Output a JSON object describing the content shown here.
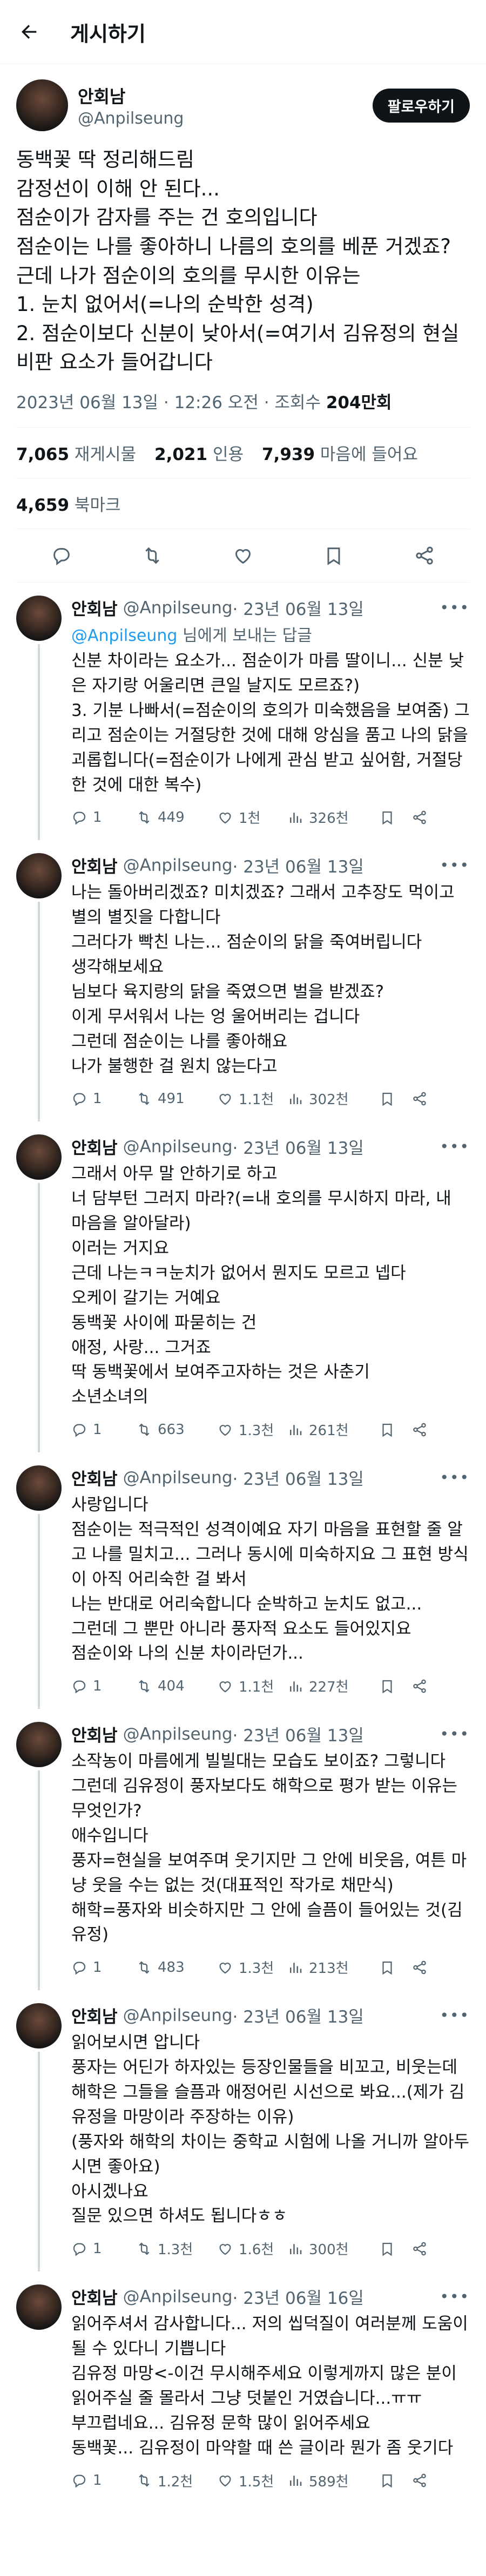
{
  "header": {
    "title": "게시하기"
  },
  "tweet": {
    "author": "안회남",
    "handle": "@Anpilseung",
    "follow_label": "팔로우하기",
    "text": "동백꽃 딱 정리해드림\n감정선이 이해 안 된다...\n점순이가 감자를 주는 건 호의입니다\n점순이는 나를 좋아하니 나름의 호의를 베푼 거겠죠?\n근데 나가 점순이의 호의를 무시한 이유는\n1. 눈치 없어서(=나의 순박한 성격)\n2. 점순이보다 신분이 낮아서(=여기서 김유정의 현실 비판 요소가 들어갑니다",
    "time": "2023년 06월 13일 · 12:26 오전 · 조회수 ",
    "views": "204만회",
    "stats": {
      "retweets_num": "7,065",
      "retweets_label": "재게시물",
      "quotes_num": "2,021",
      "quotes_label": "인용",
      "likes_num": "7,939",
      "likes_label": "마음에 들어요",
      "bookmarks_num": "4,659",
      "bookmarks_label": "북마크"
    }
  },
  "replies": [
    {
      "name": "안회남",
      "handle": "@Anpilseung",
      "date": "· 23년 06월 13일",
      "replying_mention": "@Anpilseung",
      "replying_suffix": " 님에게 보내는 답글",
      "text": "신분 차이라는 요소가... 점순이가 마름 딸이니... 신분 낮은 자기랑 어울리면 큰일 날지도 모르죠?)\n3. 기분 나빠서(=점순이의 호의가 미숙했음을 보여줌) 그리고 점순이는 거절당한 것에 대해 앙심을 품고 나의 닭을 괴롭힙니다(=점순이가 나에게 관심 받고 싶어함, 거절당한 것에 대한 복수)",
      "comments": "1",
      "retweets": "449",
      "likes": "1천",
      "views": "326천"
    },
    {
      "name": "안회남",
      "handle": "@Anpilseung",
      "date": "· 23년 06월 13일",
      "text": "나는 돌아버리겠죠? 미치겠죠? 그래서 고추장도 먹이고 별의 별짓을 다합니다\n그러다가 빡친 나는... 점순이의 닭을 죽여버립니다\n생각해보세요\n님보다 육지랑의 닭을 죽였으면 벌을 받겠죠?\n이게 무서워서 나는 엉 울어버리는 겁니다\n그런데 점순이는 나를 좋아해요\n나가 불행한 걸 원치 않는다고",
      "comments": "1",
      "retweets": "491",
      "likes": "1.1천",
      "views": "302천"
    },
    {
      "name": "안회남",
      "handle": "@Anpilseung",
      "date": "· 23년 06월 13일",
      "text": "그래서 아무 말 안하기로 하고\n너 담부턴 그러지 마라?(=내 호의를 무시하지 마라, 내 마음을 알아달라)\n이러는 거지요\n근데 나는ㅋㅋ눈치가 없어서 뭔지도 모르고 넵다\n오케이 갈기는 거예요\n동백꽃 사이에 파묻히는 건\n애정, 사랑... 그거죠\n딱 동백꽃에서 보여주고자하는 것은 사춘기\n소년소녀의",
      "comments": "1",
      "retweets": "663",
      "likes": "1.3천",
      "views": "261천"
    },
    {
      "name": "안회남",
      "handle": "@Anpilseung",
      "date": "· 23년 06월 13일",
      "text": "사랑입니다\n점순이는 적극적인 성격이예요 자기 마음을 표현할 줄 알고 나를 밀치고... 그러나 동시에 미숙하지요 그 표현 방식이 아직 어리숙한 걸 봐서\n나는 반대로 어리숙합니다 순박하고 눈치도 없고...\n그런데 그 뿐만 아니라 풍자적 요소도 들어있지요\n점순이와 나의 신분 차이라던가...",
      "comments": "1",
      "retweets": "404",
      "likes": "1.1천",
      "views": "227천"
    },
    {
      "name": "안회남",
      "handle": "@Anpilseung",
      "date": "· 23년 06월 13일",
      "text": "소작농이 마름에게 빌빌대는 모습도 보이죠? 그렇니다\n그런데 김유정이 풍자보다도 해학으로 평가 받는 이유는 무엇인가?\n애수입니다\n풍자=현실을 보여주며 웃기지만 그 안에 비웃음, 여튼 마냥 웃을 수는 없는 것(대표적인 작가로 채만식)\n해학=풍자와 비슷하지만 그 안에 슬픔이 들어있는 것(김유정)",
      "comments": "1",
      "retweets": "483",
      "likes": "1.3천",
      "views": "213천"
    },
    {
      "name": "안회남",
      "handle": "@Anpilseung",
      "date": "· 23년 06월 13일",
      "text": "읽어보시면 압니다\n풍자는 어딘가 하자있는 등장인물들을 비꼬고, 비웃는데\n해학은 그들을 슬픔과 애정어린 시선으로 봐요...(제가 김유정을 마망이라 주장하는 이유)\n(풍자와 해학의 차이는 중학교 시험에 나올 거니까 알아두시면 좋아요)\n아시겠나요\n질문 있으면 하셔도 됩니다ㅎㅎ",
      "comments": "1",
      "retweets": "1.3천",
      "likes": "1.6천",
      "views": "300천"
    },
    {
      "name": "안회남",
      "handle": "@Anpilseung",
      "date": "· 23년 06월 16일",
      "text": "읽어주셔서 감사합니다... 저의 씹덕질이 여러분께 도움이 될 수 있다니 기쁩니다\n김유정 마망<-이건 무시해주세요 이렇게까지 많은 분이 읽어주실 줄 몰라서 그냥 덧붙인 거였습니다...ㅠㅠ\n부끄럽네요... 김유정 문학 많이 읽어주세요\n동백꽃... 김유정이 마약할 때 쓴 글이라 뭔가 좀 웃기다",
      "comments": "1",
      "retweets": "1.2천",
      "likes": "1.5천",
      "views": "589천"
    }
  ]
}
